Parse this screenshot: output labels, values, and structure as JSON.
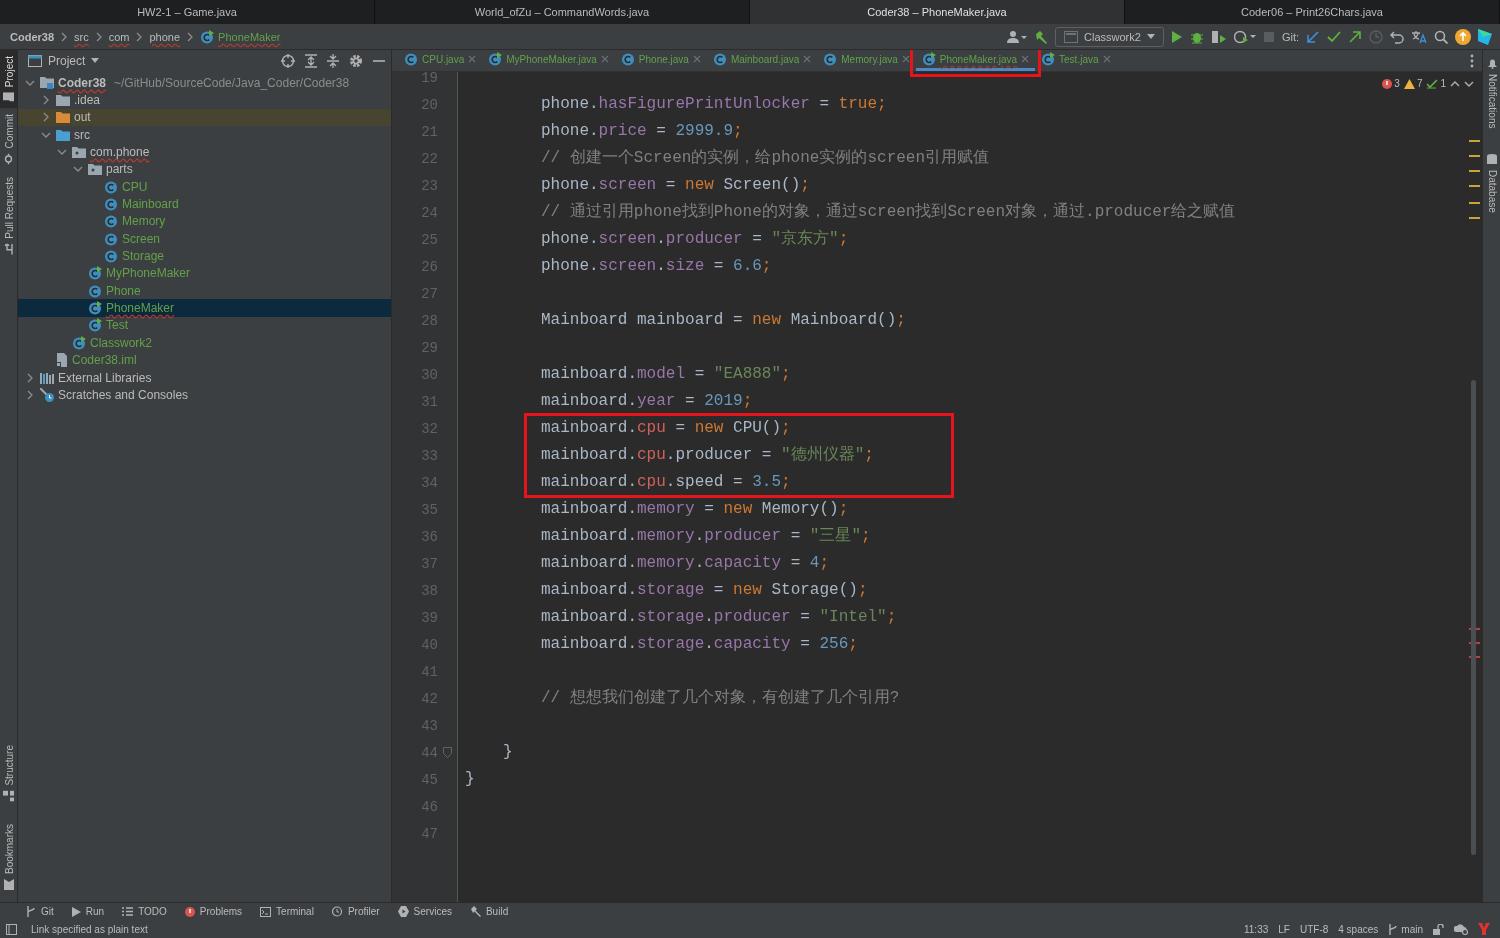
{
  "window_tabs": [
    {
      "title": "HW2-1 – Game.java",
      "selected": false
    },
    {
      "title": "World_ofZu – CommandWords.java",
      "selected": false
    },
    {
      "title": "Coder38 – PhoneMaker.java",
      "selected": true
    },
    {
      "title": "Coder06 – Print26Chars.java",
      "selected": false
    }
  ],
  "breadcrumbs": [
    {
      "label": "Coder38",
      "kind": "project",
      "underlined": false
    },
    {
      "label": "src",
      "kind": "folder",
      "underlined": true
    },
    {
      "label": "com",
      "kind": "folder",
      "underlined": true
    },
    {
      "label": "phone",
      "kind": "folder",
      "underlined": true
    },
    {
      "label": "PhoneMaker",
      "kind": "class",
      "underlined": true
    }
  ],
  "toolbar": {
    "run_config": "Classwork2",
    "git_label": "Git:"
  },
  "left_stripe": {
    "top": [
      {
        "label": "Project",
        "kind": "folder",
        "selected": true
      },
      {
        "label": "Commit",
        "kind": "commit",
        "selected": false
      },
      {
        "label": "Pull Requests",
        "kind": "pull",
        "selected": false
      }
    ],
    "bottom": [
      {
        "label": "Structure",
        "kind": "structure",
        "selected": false
      },
      {
        "label": "Bookmarks",
        "kind": "bookmark",
        "selected": false
      }
    ]
  },
  "project": {
    "title": "Project",
    "tree": [
      {
        "label": "Coder38",
        "path": "~/GitHub/SourceCode/Java_Coder/Coder38",
        "kind": "module",
        "added": false,
        "underlined": true,
        "expanded": true,
        "selected": false,
        "children": [
          {
            "label": ".idea",
            "kind": "folder",
            "added": false,
            "underlined": false,
            "expanded": false,
            "selected": false
          },
          {
            "label": "out",
            "kind": "excluded",
            "added": false,
            "underlined": false,
            "expanded": false,
            "selected": false
          },
          {
            "label": "src",
            "kind": "source",
            "added": false,
            "underlined": false,
            "expanded": true,
            "selected": false,
            "children": [
              {
                "label": "com.phone",
                "kind": "package",
                "added": false,
                "underlined": true,
                "expanded": true,
                "selected": false,
                "children": [
                  {
                    "label": "parts",
                    "kind": "package",
                    "added": false,
                    "underlined": false,
                    "expanded": true,
                    "selected": false,
                    "children": [
                      {
                        "label": "CPU",
                        "kind": "class",
                        "added": true,
                        "underlined": false,
                        "selected": false
                      },
                      {
                        "label": "Mainboard",
                        "kind": "class",
                        "added": true,
                        "underlined": false,
                        "selected": false
                      },
                      {
                        "label": "Memory",
                        "kind": "class",
                        "added": true,
                        "underlined": false,
                        "selected": false
                      },
                      {
                        "label": "Screen",
                        "kind": "class",
                        "added": true,
                        "underlined": false,
                        "selected": false
                      },
                      {
                        "label": "Storage",
                        "kind": "class",
                        "added": true,
                        "underlined": false,
                        "selected": false
                      }
                    ]
                  },
                  {
                    "label": "MyPhoneMaker",
                    "kind": "main",
                    "added": true,
                    "underlined": false,
                    "selected": false
                  },
                  {
                    "label": "Phone",
                    "kind": "class",
                    "added": true,
                    "underlined": false,
                    "selected": false
                  },
                  {
                    "label": "PhoneMaker",
                    "kind": "main",
                    "added": true,
                    "underlined": true,
                    "selected": true
                  },
                  {
                    "label": "Test",
                    "kind": "main",
                    "added": true,
                    "underlined": false,
                    "selected": false
                  }
                ]
              },
              {
                "label": "Classwork2",
                "kind": "main",
                "added": true,
                "underlined": false,
                "selected": false
              }
            ]
          },
          {
            "label": "Coder38.iml",
            "kind": "iml",
            "added": true,
            "underlined": false,
            "selected": false
          }
        ]
      },
      {
        "label": "External Libraries",
        "kind": "libraries",
        "added": false,
        "underlined": false,
        "expanded": false,
        "selected": false
      },
      {
        "label": "Scratches and Consoles",
        "kind": "scratches",
        "added": false,
        "underlined": false,
        "expanded": false,
        "selected": false
      }
    ]
  },
  "editor": {
    "tabs": [
      {
        "label": "CPU.java",
        "kind": "class",
        "selected": false,
        "underlined": false,
        "boxed": false
      },
      {
        "label": "MyPhoneMaker.java",
        "kind": "main",
        "selected": false,
        "underlined": false,
        "boxed": false
      },
      {
        "label": "Phone.java",
        "kind": "class",
        "selected": false,
        "underlined": false,
        "boxed": false
      },
      {
        "label": "Mainboard.java",
        "kind": "class",
        "selected": false,
        "underlined": false,
        "boxed": false
      },
      {
        "label": "Memory.java",
        "kind": "class",
        "selected": false,
        "underlined": false,
        "boxed": false
      },
      {
        "label": "PhoneMaker.java",
        "kind": "main",
        "selected": true,
        "underlined": true,
        "boxed": true
      },
      {
        "label": "Test.java",
        "kind": "main",
        "selected": false,
        "underlined": false,
        "boxed": false
      }
    ],
    "inspections": {
      "errors": "3",
      "warnings": "7",
      "ok": "1"
    },
    "lines": [
      {
        "number": "19",
        "kind": "blank"
      },
      {
        "number": "20",
        "kind": "statement",
        "tokens": [
          {
            "text": "phone.",
            "kind": "plain"
          },
          {
            "text": "hasFigurePrintUnlocker",
            "kind": "field"
          },
          {
            "text": " = ",
            "kind": "plain"
          },
          {
            "text": "true",
            "kind": "keyword"
          },
          {
            "text": ";",
            "kind": "keyword"
          }
        ]
      },
      {
        "number": "21",
        "kind": "statement",
        "tokens": [
          {
            "text": "phone.",
            "kind": "plain"
          },
          {
            "text": "price",
            "kind": "field"
          },
          {
            "text": " = ",
            "kind": "plain"
          },
          {
            "text": "2999.9",
            "kind": "number"
          },
          {
            "text": ";",
            "kind": "keyword"
          }
        ]
      },
      {
        "number": "22",
        "kind": "statement",
        "tokens": [
          {
            "text": "// 创建一个Screen的实例，给phone实例的screen引用赋值",
            "kind": "comment"
          }
        ]
      },
      {
        "number": "23",
        "kind": "statement",
        "tokens": [
          {
            "text": "phone.",
            "kind": "plain"
          },
          {
            "text": "screen",
            "kind": "field"
          },
          {
            "text": " = ",
            "kind": "plain"
          },
          {
            "text": "new",
            "kind": "keyword"
          },
          {
            "text": " Screen()",
            "kind": "plain"
          },
          {
            "text": ";",
            "kind": "keyword"
          }
        ]
      },
      {
        "number": "24",
        "kind": "statement",
        "tokens": [
          {
            "text": "// 通过引用phone找到Phone的对象，通过screen找到Screen对象，通过.producer给之赋值",
            "kind": "comment"
          }
        ]
      },
      {
        "number": "25",
        "kind": "statement",
        "tokens": [
          {
            "text": "phone.",
            "kind": "plain"
          },
          {
            "text": "screen",
            "kind": "field"
          },
          {
            "text": ".",
            "kind": "plain"
          },
          {
            "text": "producer",
            "kind": "field"
          },
          {
            "text": " = ",
            "kind": "plain"
          },
          {
            "text": "\"京东方\"",
            "kind": "string"
          },
          {
            "text": ";",
            "kind": "keyword"
          }
        ]
      },
      {
        "number": "26",
        "kind": "statement",
        "tokens": [
          {
            "text": "phone.",
            "kind": "plain"
          },
          {
            "text": "screen",
            "kind": "field"
          },
          {
            "text": ".",
            "kind": "plain"
          },
          {
            "text": "size",
            "kind": "field"
          },
          {
            "text": " = ",
            "kind": "plain"
          },
          {
            "text": "6.6",
            "kind": "number"
          },
          {
            "text": ";",
            "kind": "keyword"
          }
        ]
      },
      {
        "number": "27",
        "kind": "blank"
      },
      {
        "number": "28",
        "kind": "statement",
        "tokens": [
          {
            "text": "Mainboard mainboard = ",
            "kind": "plain"
          },
          {
            "text": "new",
            "kind": "keyword"
          },
          {
            "text": " Mainboard()",
            "kind": "plain"
          },
          {
            "text": ";",
            "kind": "keyword"
          }
        ]
      },
      {
        "number": "29",
        "kind": "blank"
      },
      {
        "number": "30",
        "kind": "statement",
        "tokens": [
          {
            "text": "mainboard.",
            "kind": "plain"
          },
          {
            "text": "model",
            "kind": "field"
          },
          {
            "text": " = ",
            "kind": "plain"
          },
          {
            "text": "\"EA888\"",
            "kind": "string"
          },
          {
            "text": ";",
            "kind": "keyword"
          }
        ]
      },
      {
        "number": "31",
        "kind": "statement",
        "tokens": [
          {
            "text": "mainboard.",
            "kind": "plain"
          },
          {
            "text": "year",
            "kind": "field"
          },
          {
            "text": " = ",
            "kind": "plain"
          },
          {
            "text": "2019",
            "kind": "number"
          },
          {
            "text": ";",
            "kind": "keyword"
          }
        ]
      },
      {
        "kind": "highlight_box",
        "lines": [
          {
            "number": "32",
            "kind": "statement",
            "tokens": [
              {
                "text": "mainboard.",
                "kind": "plain"
              },
              {
                "text": "cpu",
                "kind": "error"
              },
              {
                "text": " = ",
                "kind": "plain"
              },
              {
                "text": "new",
                "kind": "keyword"
              },
              {
                "text": " CPU()",
                "kind": "plain"
              },
              {
                "text": ";",
                "kind": "keyword"
              }
            ]
          },
          {
            "number": "33",
            "kind": "statement",
            "tokens": [
              {
                "text": "mainboard.",
                "kind": "plain"
              },
              {
                "text": "cpu",
                "kind": "error"
              },
              {
                "text": ".producer = ",
                "kind": "plain"
              },
              {
                "text": "\"德州仪器\"",
                "kind": "string"
              },
              {
                "text": ";",
                "kind": "keyword"
              }
            ]
          },
          {
            "number": "34",
            "kind": "statement",
            "tokens": [
              {
                "text": "mainboard.",
                "kind": "plain"
              },
              {
                "text": "cpu",
                "kind": "error"
              },
              {
                "text": ".speed = ",
                "kind": "plain"
              },
              {
                "text": "3.5",
                "kind": "number"
              },
              {
                "text": ";",
                "kind": "keyword"
              }
            ]
          }
        ]
      },
      {
        "number": "35",
        "kind": "statement",
        "tokens": [
          {
            "text": "mainboard.",
            "kind": "plain"
          },
          {
            "text": "memory",
            "kind": "field"
          },
          {
            "text": " = ",
            "kind": "plain"
          },
          {
            "text": "new",
            "kind": "keyword"
          },
          {
            "text": " Memory()",
            "kind": "plain"
          },
          {
            "text": ";",
            "kind": "keyword"
          }
        ]
      },
      {
        "number": "36",
        "kind": "statement",
        "tokens": [
          {
            "text": "mainboard.",
            "kind": "plain"
          },
          {
            "text": "memory",
            "kind": "field"
          },
          {
            "text": ".",
            "kind": "plain"
          },
          {
            "text": "producer",
            "kind": "field"
          },
          {
            "text": " = ",
            "kind": "plain"
          },
          {
            "text": "\"三星\"",
            "kind": "string"
          },
          {
            "text": ";",
            "kind": "keyword"
          }
        ]
      },
      {
        "number": "37",
        "kind": "statement",
        "tokens": [
          {
            "text": "mainboard.",
            "kind": "plain"
          },
          {
            "text": "memory",
            "kind": "field"
          },
          {
            "text": ".",
            "kind": "plain"
          },
          {
            "text": "capacity",
            "kind": "field"
          },
          {
            "text": " = ",
            "kind": "plain"
          },
          {
            "text": "4",
            "kind": "number"
          },
          {
            "text": ";",
            "kind": "keyword"
          }
        ]
      },
      {
        "number": "38",
        "kind": "statement",
        "tokens": [
          {
            "text": "mainboard.",
            "kind": "plain"
          },
          {
            "text": "storage",
            "kind": "field"
          },
          {
            "text": " = ",
            "kind": "plain"
          },
          {
            "text": "new",
            "kind": "keyword"
          },
          {
            "text": " Storage()",
            "kind": "plain"
          },
          {
            "text": ";",
            "kind": "keyword"
          }
        ]
      },
      {
        "number": "39",
        "kind": "statement",
        "tokens": [
          {
            "text": "mainboard.",
            "kind": "plain"
          },
          {
            "text": "storage",
            "kind": "field"
          },
          {
            "text": ".",
            "kind": "plain"
          },
          {
            "text": "producer",
            "kind": "field"
          },
          {
            "text": " = ",
            "kind": "plain"
          },
          {
            "text": "\"Intel\"",
            "kind": "string"
          },
          {
            "text": ";",
            "kind": "keyword"
          }
        ]
      },
      {
        "number": "40",
        "kind": "statement",
        "tokens": [
          {
            "text": "mainboard.",
            "kind": "plain"
          },
          {
            "text": "storage",
            "kind": "field"
          },
          {
            "text": ".",
            "kind": "plain"
          },
          {
            "text": "capacity",
            "kind": "field"
          },
          {
            "text": " = ",
            "kind": "plain"
          },
          {
            "text": "256",
            "kind": "number"
          },
          {
            "text": ";",
            "kind": "keyword"
          }
        ]
      },
      {
        "number": "41",
        "kind": "blank"
      },
      {
        "number": "42",
        "kind": "statement",
        "tokens": [
          {
            "text": "// 想想我们创建了几个对象，有创建了几个引用?",
            "kind": "comment"
          }
        ]
      },
      {
        "number": "43",
        "kind": "blank"
      },
      {
        "number": "44",
        "kind": "method_close",
        "tokens": [
          {
            "text": "}",
            "kind": "plain"
          }
        ]
      },
      {
        "number": "45",
        "kind": "class_close",
        "tokens": [
          {
            "text": "}",
            "kind": "plain"
          }
        ]
      },
      {
        "number": "46",
        "kind": "blank"
      },
      {
        "number": "47",
        "kind": "blank"
      }
    ]
  },
  "right_stripe": [
    {
      "label": "Notifications",
      "kind": "bell"
    },
    {
      "label": "Database",
      "kind": "database"
    }
  ],
  "tool_windows": [
    {
      "label": "Git",
      "kind": "git"
    },
    {
      "label": "Run",
      "kind": "run"
    },
    {
      "label": "TODO",
      "kind": "todo"
    },
    {
      "label": "Problems",
      "kind": "problems"
    },
    {
      "label": "Terminal",
      "kind": "terminal"
    },
    {
      "label": "Profiler",
      "kind": "profiler"
    },
    {
      "label": "Services",
      "kind": "services"
    },
    {
      "label": "Build",
      "kind": "build"
    }
  ],
  "status_bar": {
    "message": "Link specified as plain text",
    "items": [
      "11:33",
      "LF",
      "UTF-8",
      "4 spaces"
    ],
    "branch": "main"
  }
}
